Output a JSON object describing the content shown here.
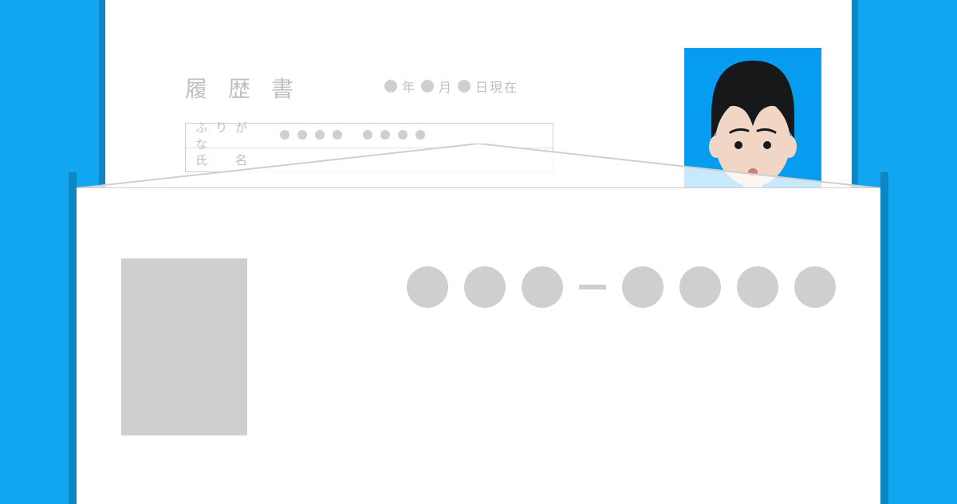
{
  "resume": {
    "title": "履歴書",
    "date_labels": {
      "year": "年",
      "month": "月",
      "day_suffix": "日現在"
    },
    "rows": {
      "furigana": "ふりがな",
      "name": "氏　名"
    }
  },
  "colors": {
    "bg": "#12a6f2",
    "photo_bg": "#069cef",
    "placeholder": "#cfcfcf",
    "shadow": "#0d86c4",
    "hair": "#17181a",
    "skin": "#f1d6c6"
  }
}
